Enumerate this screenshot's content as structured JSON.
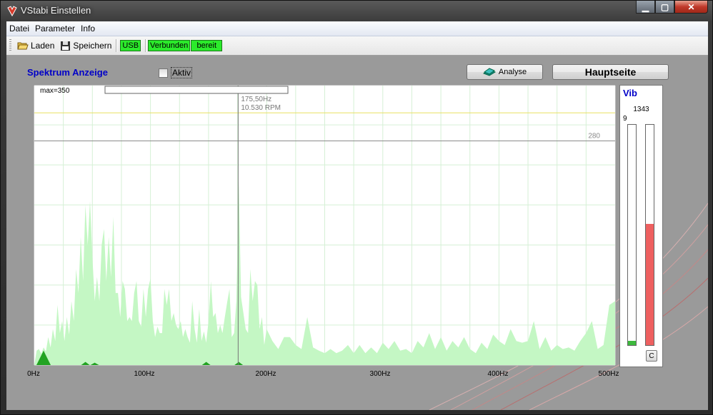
{
  "window": {
    "title": "VStabi Einstellen",
    "app_icon": "vstabi-logo-icon"
  },
  "menu": [
    "Datei",
    "Parameter",
    "Info"
  ],
  "toolbar": {
    "load_label": "Laden",
    "save_label": "Speichern",
    "usb_label": "USB",
    "status_connected": "Verbunden",
    "status_ready": "bereit",
    "status_color": "#2bea2b"
  },
  "panel": {
    "title": "Spektrum Anzeige",
    "aktiv_label": "Aktiv",
    "aktiv_checked": false,
    "analyse_label": "Analyse",
    "hauptseite_label": "Hauptseite"
  },
  "chart_data": {
    "type": "area",
    "max_label": "max=350",
    "xlim": [
      0,
      500
    ],
    "ylim": [
      0,
      350
    ],
    "x_ticks": [
      "0Hz",
      "100Hz",
      "200Hz",
      "300Hz",
      "400Hz",
      "500Hz"
    ],
    "cursor": {
      "x": 175.5,
      "freq_label": "175,50Hz",
      "rpm_label": "10.530 RPM"
    },
    "threshold": {
      "value": 280,
      "label": "280"
    },
    "reference_line": 315,
    "fill_color": "#c4f7c4",
    "x": [
      0,
      2,
      4,
      6,
      8,
      10,
      12,
      14,
      16,
      18,
      20,
      22,
      24,
      26,
      28,
      30,
      32,
      34,
      36,
      38,
      40,
      42,
      44,
      46,
      48,
      50,
      52,
      54,
      56,
      58,
      60,
      62,
      64,
      66,
      68,
      70,
      72,
      74,
      76,
      78,
      80,
      82,
      84,
      86,
      88,
      90,
      92,
      94,
      96,
      98,
      100,
      102,
      104,
      106,
      108,
      110,
      112,
      114,
      116,
      118,
      120,
      122,
      124,
      126,
      128,
      130,
      132,
      134,
      136,
      138,
      140,
      142,
      144,
      146,
      148,
      150,
      152,
      154,
      156,
      158,
      160,
      162,
      164,
      166,
      168,
      170,
      172,
      174,
      176,
      178,
      180,
      182,
      184,
      186,
      188,
      190,
      192,
      194,
      196,
      198,
      200,
      205,
      210,
      215,
      220,
      225,
      230,
      235,
      240,
      245,
      250,
      255,
      260,
      265,
      270,
      275,
      280,
      285,
      290,
      295,
      300,
      305,
      310,
      315,
      320,
      325,
      330,
      335,
      340,
      345,
      350,
      355,
      360,
      365,
      370,
      375,
      380,
      385,
      390,
      395,
      400,
      405,
      410,
      415,
      420,
      425,
      430,
      435,
      440,
      445,
      450,
      455,
      460,
      465,
      470,
      475,
      480,
      485,
      490,
      495,
      500
    ],
    "values": [
      0,
      18,
      20,
      14,
      22,
      17,
      35,
      22,
      45,
      30,
      75,
      40,
      55,
      30,
      60,
      38,
      80,
      55,
      120,
      90,
      160,
      105,
      200,
      150,
      205,
      135,
      80,
      110,
      80,
      150,
      170,
      105,
      160,
      110,
      185,
      90,
      90,
      60,
      105,
      95,
      55,
      60,
      55,
      90,
      105,
      55,
      48,
      95,
      60,
      95,
      108,
      55,
      35,
      48,
      40,
      40,
      95,
      75,
      95,
      55,
      65,
      50,
      45,
      55,
      35,
      45,
      35,
      28,
      80,
      45,
      28,
      70,
      30,
      42,
      28,
      55,
      105,
      60,
      65,
      40,
      50,
      40,
      60,
      78,
      95,
      35,
      40,
      80,
      230,
      85,
      65,
      45,
      40,
      120,
      80,
      105,
      100,
      45,
      60,
      25,
      45,
      30,
      20,
      35,
      35,
      25,
      20,
      60,
      22,
      18,
      15,
      20,
      15,
      18,
      25,
      15,
      25,
      15,
      22,
      15,
      28,
      20,
      30,
      18,
      20,
      15,
      30,
      22,
      40,
      20,
      35,
      18,
      30,
      22,
      35,
      20,
      15,
      28,
      20,
      38,
      30,
      25,
      45,
      30,
      28,
      30,
      55,
      20,
      35,
      18,
      25,
      20,
      22,
      18,
      30,
      40,
      55,
      20,
      25,
      75,
      80
    ],
    "peaks": [
      {
        "x": 8,
        "value": 18
      },
      {
        "x": 44,
        "value": 4
      },
      {
        "x": 52,
        "value": 3
      },
      {
        "x": 148,
        "value": 4
      },
      {
        "x": 176,
        "value": 4
      }
    ],
    "peak_color": "#22a322"
  },
  "vib": {
    "title": "Vib",
    "value": "1343",
    "small_value": "9",
    "left_level": 0.02,
    "right_level": 0.55,
    "left_color": "#3db93d",
    "right_color": "#ee6060",
    "reset_label": "C"
  }
}
